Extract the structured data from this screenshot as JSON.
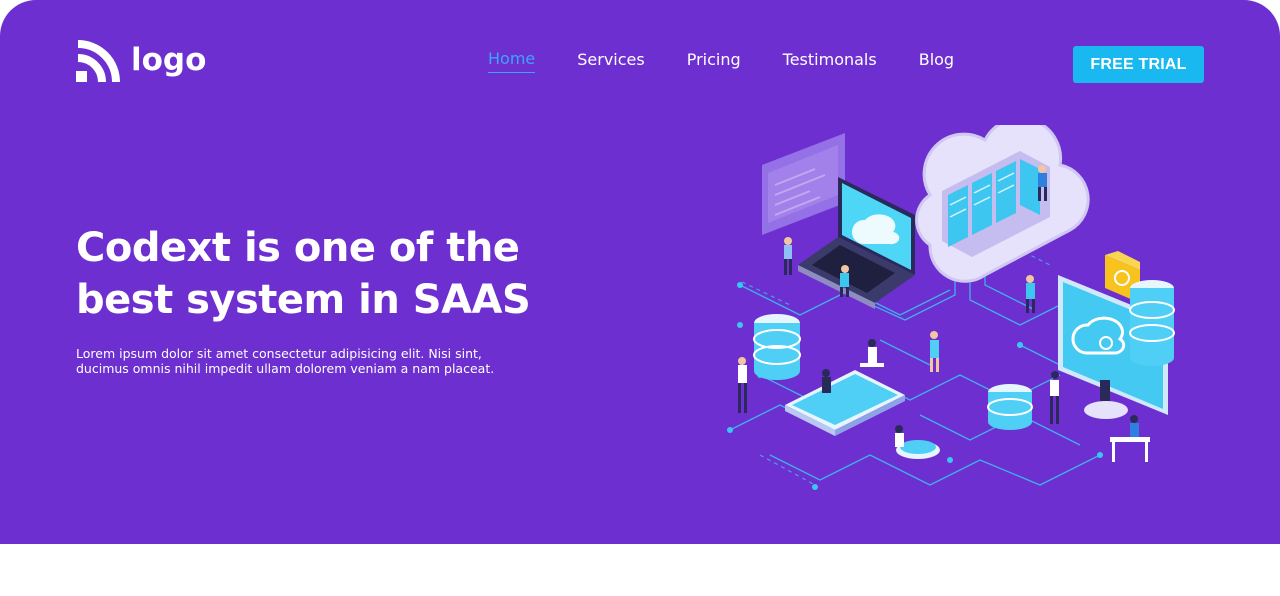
{
  "brand": {
    "logo_text": "logo",
    "logo_icon": "wifi-signal-logo-icon"
  },
  "nav": {
    "items": [
      {
        "label": "Home",
        "active": true
      },
      {
        "label": "Services",
        "active": false
      },
      {
        "label": "Pricing",
        "active": false
      },
      {
        "label": "Testimonals",
        "active": false
      },
      {
        "label": "Blog",
        "active": false
      }
    ],
    "cta_label": "FREE TRIAL"
  },
  "hero": {
    "headline_line1": "Codext is one of the",
    "headline_line2": "best system in SAAS",
    "subtext_line1": "Lorem ipsum dolor sit amet consectetur adipisicing elit. Nisi sint,",
    "subtext_line2": "ducimus omnis nihil impedit ullam dolorem veniam a nam placeat.",
    "illustration": "isometric-cloud-network-illustration"
  },
  "colors": {
    "hero_background": "#6d2fcf",
    "accent": "#1ab8f0",
    "active_link": "#3ea3ff",
    "page_background": "#ffffff"
  }
}
